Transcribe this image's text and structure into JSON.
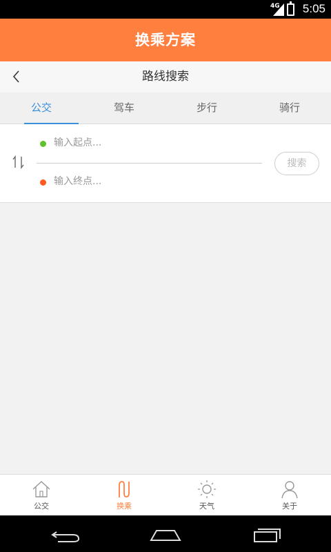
{
  "status_bar": {
    "network": "4G",
    "time": "5:05"
  },
  "app_bar": {
    "title": "换乘方案"
  },
  "sub_header": {
    "title": "路线搜索",
    "back_icon": "chevron-left-icon"
  },
  "tabs": [
    {
      "label": "公交",
      "active": true
    },
    {
      "label": "驾车",
      "active": false
    },
    {
      "label": "步行",
      "active": false
    },
    {
      "label": "骑行",
      "active": false
    }
  ],
  "route": {
    "swap_icon": "swap-arrows-icon",
    "start": {
      "placeholder": "输入起点...",
      "value": "",
      "color": "#5fc22c"
    },
    "end": {
      "placeholder": "输入终点...",
      "value": "",
      "color": "#ff5a1f"
    },
    "search_label": "搜索"
  },
  "bottom_nav": [
    {
      "label": "公交",
      "icon": "home-icon",
      "active": false
    },
    {
      "label": "换乘",
      "icon": "transfer-icon",
      "active": true
    },
    {
      "label": "天气",
      "icon": "sun-icon",
      "active": false
    },
    {
      "label": "关于",
      "icon": "person-icon",
      "active": false
    }
  ],
  "system_nav": [
    "back-icon",
    "home-icon",
    "recents-icon"
  ],
  "colors": {
    "accent": "#ff7f3f",
    "tab_active": "#3a8fd8"
  }
}
